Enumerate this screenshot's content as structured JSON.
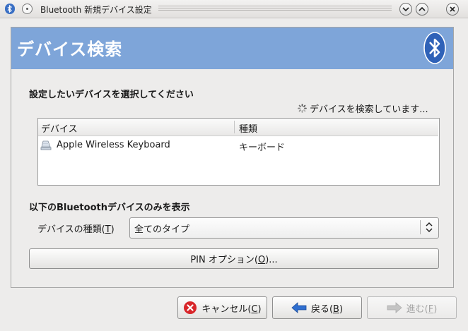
{
  "window": {
    "title": "Bluetooth 新規デバイス設定"
  },
  "banner": {
    "title": "デバイス検索"
  },
  "select_section": {
    "label": "設定したいデバイスを選択してください",
    "searching_status": "デバイスを検索しています..."
  },
  "device_list": {
    "columns": [
      "デバイス",
      "種類"
    ],
    "rows": [
      {
        "name": "Apple Wireless Keyboard",
        "type": "キーボード",
        "icon": "keyboard-icon"
      }
    ]
  },
  "filter_section": {
    "label": "以下のBluetoothデバイスのみを表示",
    "device_type_label": "デバイスの種類(",
    "device_type_mnemonic": "T",
    "device_type_label_end": ")",
    "device_type_value": "全てのタイプ"
  },
  "pin_button": {
    "label": "PIN オプション(",
    "mnemonic": "O",
    "label_end": ")..."
  },
  "footer": {
    "cancel": {
      "label": "キャンセル(",
      "mnemonic": "C",
      "label_end": ")"
    },
    "back": {
      "label": "戻る(",
      "mnemonic": "B",
      "label_end": ")"
    },
    "forward": {
      "label": "進む(",
      "mnemonic": "F",
      "label_end": ")"
    }
  },
  "colors": {
    "banner": "#7ea5d9",
    "bluetooth_logo": "#2f62b8",
    "cancel_icon": "#d8262a",
    "back_arrow": "#2f6fd0"
  }
}
